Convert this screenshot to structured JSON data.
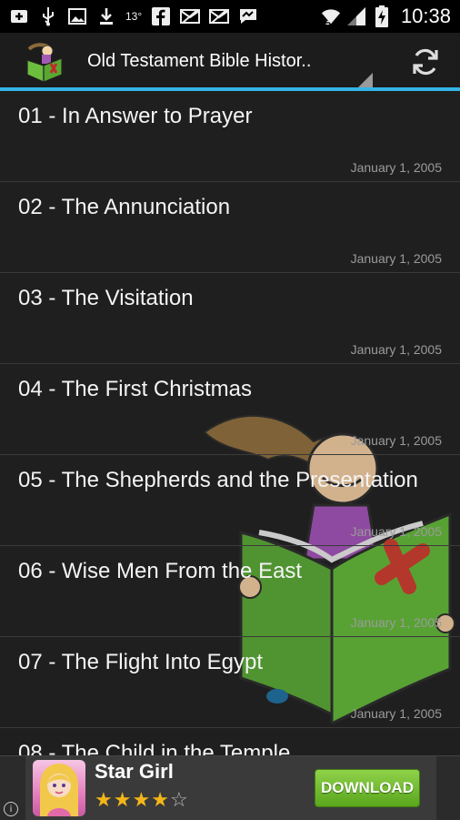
{
  "status_bar": {
    "icons_left": [
      "add-icon",
      "usb-icon",
      "image-icon",
      "download-icon"
    ],
    "temperature": "13°",
    "icons_mid": [
      "facebook-icon",
      "mail-off-icon",
      "mail-off-icon",
      "messenger-icon"
    ],
    "icons_right": [
      "wifi-icon",
      "signal-icon",
      "battery-charging-icon"
    ],
    "time": "10:38"
  },
  "action_bar": {
    "title": "Old Testament Bible Histor..",
    "refresh_icon": "refresh-icon",
    "accent_color": "#33b5e5"
  },
  "list": {
    "items": [
      {
        "title": "01 - In Answer to Prayer",
        "date": "January 1, 2005"
      },
      {
        "title": "02 - The Annunciation",
        "date": "January 1, 2005"
      },
      {
        "title": "03 - The Visitation",
        "date": "January 1, 2005"
      },
      {
        "title": "04 - The First Christmas",
        "date": "January 1, 2005"
      },
      {
        "title": "05 - The Shepherds and the Presentation",
        "date": "January 1, 2005"
      },
      {
        "title": "06 - Wise Men From the East",
        "date": "January 1, 2005"
      },
      {
        "title": "07 - The Flight Into Egypt",
        "date": "January 1, 2005"
      },
      {
        "title": "08 - The Child in the Temple",
        "date": ""
      }
    ]
  },
  "ad": {
    "app_name": "Star Girl",
    "rating": 4,
    "max_rating": 5,
    "button_label": "DOWNLOAD",
    "info_label": "i"
  }
}
